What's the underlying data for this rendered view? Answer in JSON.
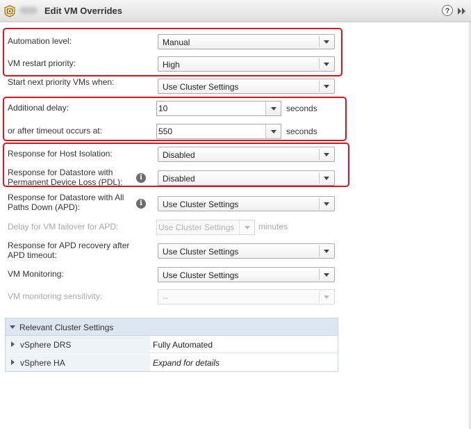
{
  "window": {
    "title": "Edit VM Overrides",
    "help_glyph": "?",
    "app_icon": "vm-settings-icon",
    "forward_icon": "double-chevron-right-icon"
  },
  "form": {
    "automation_level": {
      "label": "Automation level:",
      "value": "Manual"
    },
    "vm_restart_priority": {
      "label": "VM restart priority:",
      "value": "High"
    },
    "start_next_priority": {
      "label": "Start next priority VMs when:",
      "value": "Use Cluster Settings"
    },
    "additional_delay": {
      "label": "Additional delay:",
      "value": "10",
      "unit": "seconds"
    },
    "after_timeout": {
      "label": "or after timeout occurs at:",
      "value": "550",
      "unit": "seconds"
    },
    "host_isolation": {
      "label": "Response for Host Isolation:",
      "value": "Disabled"
    },
    "datastore_pdl": {
      "label": "Response for Datastore with Permanent Device Loss (PDL):",
      "value": "Disabled"
    },
    "datastore_apd": {
      "label": "Response for Datastore with All Paths Down (APD):",
      "value": "Use Cluster Settings"
    },
    "apd_failover_delay": {
      "label": "Delay for VM failover for APD:",
      "value": "Use Cluster Settings",
      "unit": "minutes"
    },
    "apd_recovery": {
      "label": "Response for APD recovery after APD timeout:",
      "value": "Use Cluster Settings"
    },
    "vm_monitoring": {
      "label": "VM Monitoring:",
      "value": "Use Cluster Settings"
    },
    "vm_monitoring_sensitivity": {
      "label": "VM monitoring sensitivity:",
      "value": "--"
    },
    "info_glyph": "i"
  },
  "cluster_settings": {
    "title": "Relevant Cluster Settings",
    "rows": [
      {
        "name": "vSphere DRS",
        "value": "Fully Automated"
      },
      {
        "name": "vSphere HA",
        "value": "Expand for details"
      }
    ]
  },
  "colors": {
    "highlight_box": "#d6141e",
    "cluster_header": "#dde7f1",
    "disabled_text": "#a8a8a8"
  }
}
